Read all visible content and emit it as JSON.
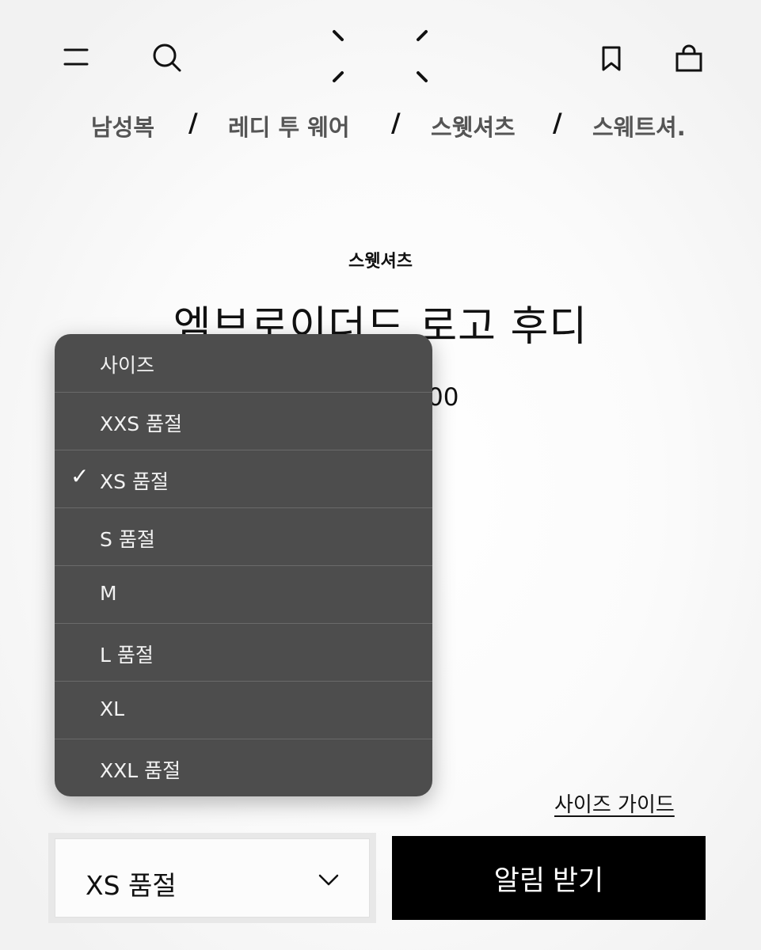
{
  "header": {
    "icons": [
      "menu-icon",
      "search-icon",
      "bookmark-icon",
      "shopping-bag-icon"
    ]
  },
  "breadcrumb": {
    "items": [
      "남성복",
      "레디 투 웨어",
      "스웻셔츠",
      "스웨트셔."
    ],
    "separator": "/"
  },
  "product": {
    "category": "스웻셔츠",
    "title": "엠브로이더드 로고 후디",
    "price_visible": "00"
  },
  "size_dropdown": {
    "selected_index": 2,
    "options": [
      "사이즈",
      "XXS 품절",
      "XS 품절",
      "S 품절",
      "M",
      "L 품절",
      "XL",
      "XXL 품절"
    ],
    "check_glyph": "✓"
  },
  "size_guide_label": "사이즈 가이드",
  "size_select": {
    "value": "XS 품절"
  },
  "notify_button_label": "알림 받기",
  "colors": {
    "dropdown_bg": "#4d4d4d",
    "button_bg": "#000000"
  }
}
